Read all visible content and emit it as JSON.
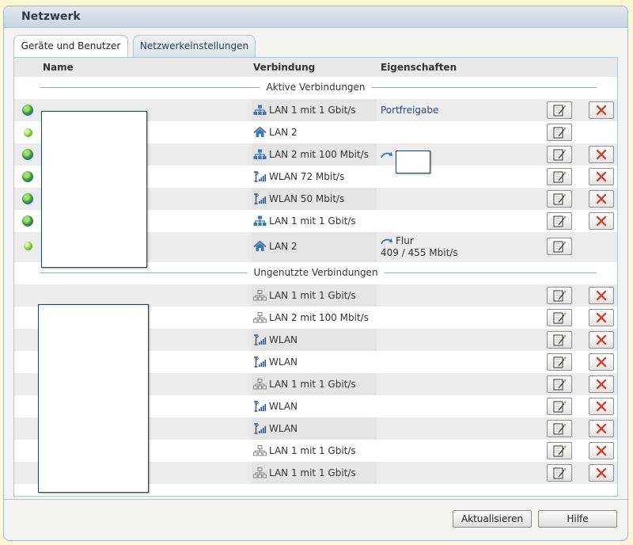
{
  "header": {
    "title": "Netzwerk"
  },
  "tabs": [
    {
      "label": "Geräte und Benutzer",
      "active": true
    },
    {
      "label": "Netzwerkeinstellungen",
      "active": false
    }
  ],
  "columns": {
    "name": "Name",
    "connection": "Verbindung",
    "properties": "Eigenschaften"
  },
  "sections": {
    "active": "Aktive Verbindungen",
    "unused": "Ungenutzte Verbindungen"
  },
  "active_rows": [
    {
      "status": "globe",
      "icon": "lan-icon",
      "connection": "LAN 1 mit 1 Gbit/s",
      "property": "Portfreigabe",
      "property_link": true,
      "deletable": true
    },
    {
      "status": "dot",
      "icon": "home-icon",
      "connection": "LAN 2",
      "property": "",
      "deletable": false
    },
    {
      "status": "globe",
      "icon": "lan-icon",
      "connection": "LAN 2 mit 100 Mbit/s",
      "property": "",
      "repeater": true,
      "deletable": true
    },
    {
      "status": "globe",
      "icon": "wlan-icon",
      "connection": "WLAN 72 Mbit/s",
      "property": "",
      "deletable": true
    },
    {
      "status": "globe",
      "icon": "wlan-icon",
      "connection": "WLAN 50 Mbit/s",
      "property": "",
      "deletable": true
    },
    {
      "status": "globe",
      "icon": "lan-icon",
      "connection": "LAN 1 mit 1 Gbit/s",
      "property": "",
      "deletable": true
    },
    {
      "status": "dot",
      "icon": "home-icon",
      "connection": "LAN 2",
      "property": "Flur",
      "property_line2": "409 / 455 Mbit/s",
      "repeater": true,
      "deletable": false
    }
  ],
  "unused_rows": [
    {
      "icon": "lan-gray-icon",
      "connection": "LAN 1 mit 1 Gbit/s"
    },
    {
      "icon": "lan-gray-icon",
      "connection": "LAN 2 mit 100 Mbit/s"
    },
    {
      "icon": "wlan-icon",
      "connection": "WLAN"
    },
    {
      "icon": "wlan-icon",
      "connection": "WLAN"
    },
    {
      "icon": "lan-gray-icon",
      "connection": "LAN 1 mit 1 Gbit/s"
    },
    {
      "icon": "wlan-icon",
      "connection": "WLAN"
    },
    {
      "icon": "wlan-icon",
      "connection": "WLAN"
    },
    {
      "icon": "lan-gray-icon",
      "connection": "LAN 1 mit 1 Gbit/s"
    },
    {
      "icon": "lan-gray-icon",
      "connection": "LAN 1 mit 1 Gbit/s"
    }
  ],
  "footer": {
    "refresh": "Aktualisieren",
    "help": "Hilfe"
  },
  "colors": {
    "link": "#2a4d7a",
    "delete": "#e0301e",
    "header_bg": "#c8d6e2",
    "page_bg": "#fbf8d6"
  }
}
